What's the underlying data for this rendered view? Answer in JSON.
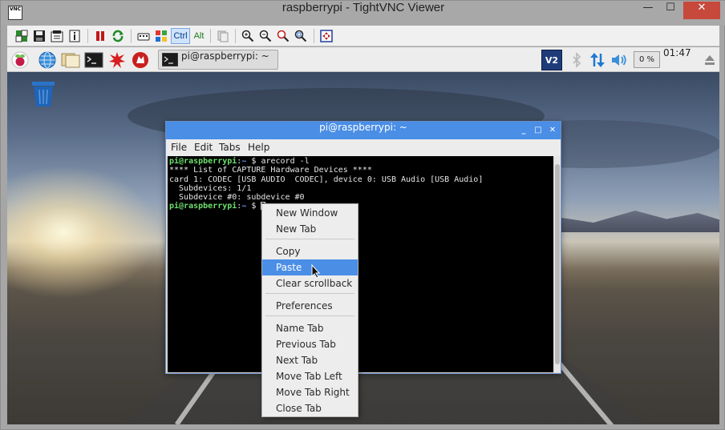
{
  "window": {
    "title": "raspberrypi - TightVNC Viewer",
    "app_icon_label": "VNC",
    "minimize_glyph": "—",
    "maximize_glyph": "☐",
    "close_glyph": "✕"
  },
  "vnc_toolbar": {
    "ctrl_label": "Ctrl",
    "alt_label": "Alt"
  },
  "panel": {
    "task_label": "pi@raspberrypi: ~",
    "vnc_tray_label": "V2",
    "cpu_label": "0 %",
    "clock": "01:47"
  },
  "terminal": {
    "title": "pi@raspberrypi: ~",
    "menu": [
      "File",
      "Edit",
      "Tabs",
      "Help"
    ],
    "prompt_user": "pi@raspberrypi",
    "prompt_path": "~",
    "prompt_sign": "$",
    "command": "arecord -l",
    "output": [
      "**** List of CAPTURE Hardware Devices ****",
      "card 1: CODEC [USB AUDIO  CODEC], device 0: USB Audio [USB Audio]",
      "  Subdevices: 1/1",
      "  Subdevice #0: subdevice #0"
    ]
  },
  "context_menu": {
    "items": [
      "New Window",
      "New Tab",
      "Copy",
      "Paste",
      "Clear scrollback",
      "Preferences",
      "Name Tab",
      "Previous Tab",
      "Next Tab",
      "Move Tab Left",
      "Move Tab Right",
      "Close Tab"
    ],
    "highlighted": "Paste"
  },
  "colors": {
    "accent": "#4a8ee6",
    "prompt_green": "#6ee06e",
    "prompt_blue": "#6e9cf0"
  }
}
